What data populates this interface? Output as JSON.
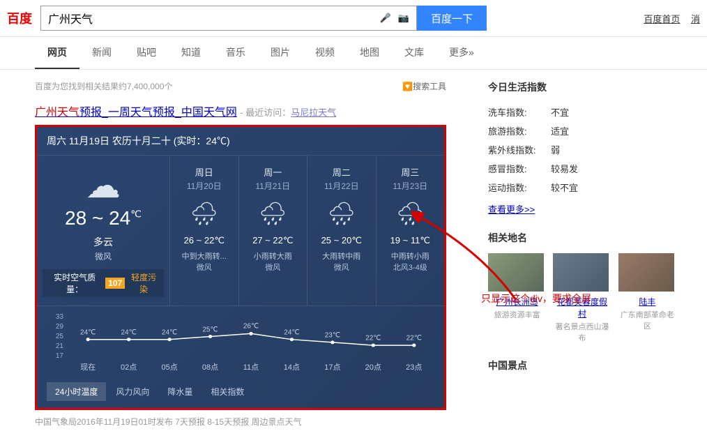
{
  "logo": "百度",
  "search": {
    "value": "广州天气",
    "button": "百度一下"
  },
  "header_links": {
    "home": "百度首页",
    "msg": "消"
  },
  "tabs": [
    "网页",
    "新闻",
    "贴吧",
    "知道",
    "音乐",
    "图片",
    "视频",
    "地图",
    "文库",
    "更多»"
  ],
  "stats": "百度为您找到相关结果约7,400,000个",
  "filter": "🔽搜索工具",
  "result": {
    "hl": "广州天气",
    "rest": "预报_一周天气预报_中国天气网",
    "meta_prefix": " - 最近访问：",
    "meta_link": "马尼拉天气"
  },
  "weather": {
    "header": "周六 11月19日 农历十月二十 (实时：24℃)",
    "today": {
      "temp": "28 ~ 24",
      "unit": "℃",
      "desc": "多云",
      "wind": "微风",
      "aqi_label": "实时空气质量：",
      "aqi_value": "107",
      "aqi_grade": "轻度污染"
    },
    "forecast": [
      {
        "dow": "周日",
        "date": "11月20日",
        "temp": "26 ~ 22℃",
        "desc": "中到大雨转...",
        "wind": "微风"
      },
      {
        "dow": "周一",
        "date": "11月21日",
        "temp": "27 ~ 22℃",
        "desc": "小雨转大雨",
        "wind": "微风"
      },
      {
        "dow": "周二",
        "date": "11月22日",
        "temp": "25 ~ 20℃",
        "desc": "大雨转中雨",
        "wind": "微风"
      },
      {
        "dow": "周三",
        "date": "11月23日",
        "temp": "19 ~ 11℃",
        "desc": "中雨转小雨",
        "wind": "北风3-4级"
      }
    ],
    "chart_tabs": [
      "24小时温度",
      "风力风向",
      "降水量",
      "相关指数"
    ]
  },
  "chart_data": {
    "type": "line",
    "title": "",
    "xlabel": "",
    "ylabel": "",
    "ylim": [
      17,
      33
    ],
    "y_ticks": [
      33,
      29,
      25,
      21,
      17
    ],
    "categories": [
      "现在",
      "02点",
      "05点",
      "08点",
      "11点",
      "14点",
      "17点",
      "20点",
      "23点"
    ],
    "values": [
      24,
      24,
      24,
      25,
      26,
      24,
      23,
      22,
      22
    ],
    "value_labels": [
      "24℃",
      "24℃",
      "24℃",
      "25℃",
      "26℃",
      "24℃",
      "23℃",
      "22℃",
      "22℃"
    ]
  },
  "footer": "中国气象局2016年11月19日01时发布  7天预报   8-15天预报   周边景点天气",
  "sidebar": {
    "life_title": "今日生活指数",
    "indices": [
      {
        "k": "洗车指数:",
        "v": "不宜"
      },
      {
        "k": "旅游指数:",
        "v": "适宜"
      },
      {
        "k": "紫外线指数:",
        "v": "弱"
      },
      {
        "k": "感冒指数:",
        "v": "较易发"
      },
      {
        "k": "运动指数:",
        "v": "较不宜"
      }
    ],
    "more": "查看更多>>",
    "places_title": "相关地名",
    "places": [
      {
        "name": "广州长洲岛",
        "desc": "旅游资源丰富"
      },
      {
        "name": "花都芙蓉度假村",
        "desc": "著名景点西山瀑布"
      },
      {
        "name": "陆丰",
        "desc": "广东南部革命老区"
      }
    ],
    "spots_title": "中国景点"
  },
  "annotation": "只显示这个div，要求全屏"
}
